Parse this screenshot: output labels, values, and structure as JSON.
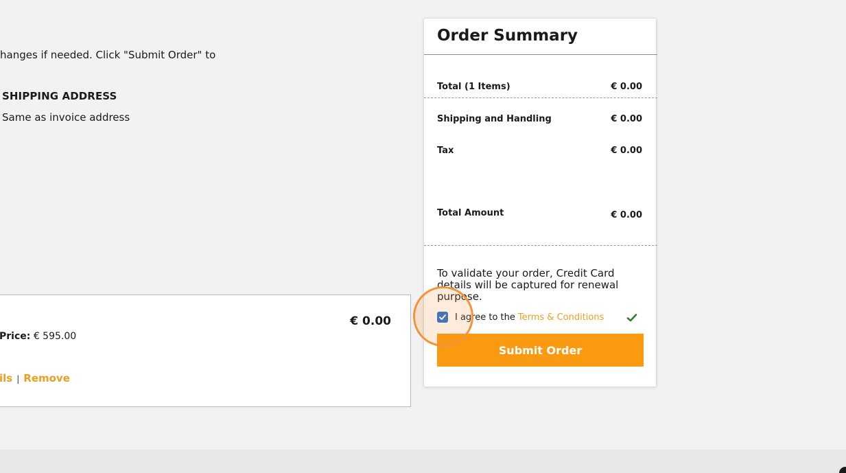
{
  "review": {
    "instructions": "hanges if needed. Click \"Submit Order\" to",
    "shipping_heading": "SHIPPING ADDRESS",
    "shipping_value": "Same as invoice address"
  },
  "item": {
    "price": "€ 0.00",
    "unit_price_label": "Price:",
    "unit_price_value": "€ 595.00",
    "details_link": "ils",
    "separator": "|",
    "remove_link": "Remove"
  },
  "summary": {
    "title": "Order Summary",
    "rows": [
      {
        "label": "Total (1 Items)",
        "value": "€ 0.00"
      },
      {
        "label": "Shipping and Handling",
        "value": "€ 0.00"
      },
      {
        "label": "Tax",
        "value": "€ 0.00"
      },
      {
        "label": "Total Amount",
        "value": "€ 0.00"
      }
    ],
    "validation_note": "To validate your order, Credit Card details will be captured for renewal purpose.",
    "agree_text": "I agree to the",
    "terms_link": "Terms & Conditions",
    "agree_checked": true,
    "submit_label": "Submit Order"
  },
  "colors": {
    "accent": "#f99a10",
    "link": "#e8a020",
    "checkbox": "#1f6fd6",
    "valid_check": "#2e7d32",
    "highlight_ring": "#f5923a"
  },
  "icons": {
    "checkbox_mark": "checkmark-icon",
    "valid": "checkmark-icon"
  }
}
